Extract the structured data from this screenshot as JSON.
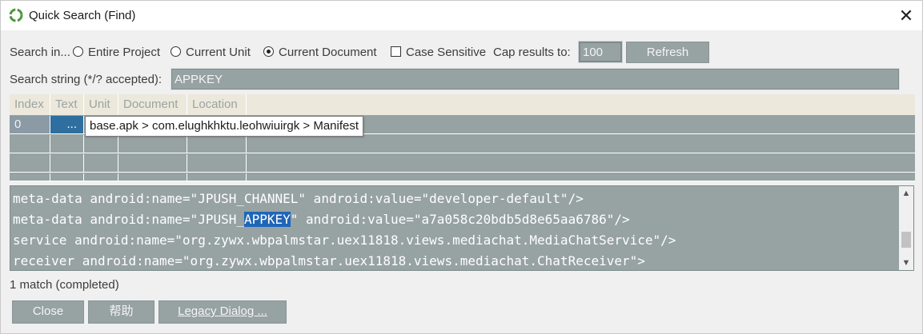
{
  "window": {
    "title": "Quick Search (Find)",
    "close_glyph": "✕"
  },
  "options": {
    "search_in_label": "Search in...",
    "scope_options": [
      {
        "label": "Entire Project",
        "checked": false
      },
      {
        "label": "Current Unit",
        "checked": false
      },
      {
        "label": "Current Document",
        "checked": true
      }
    ],
    "case_sensitive_label": "Case Sensitive",
    "case_sensitive_checked": false,
    "cap_label": "Cap results to:",
    "cap_value": "100",
    "refresh_label": "Refresh"
  },
  "search": {
    "label": "Search string (*/? accepted):",
    "value": "APPKEY"
  },
  "results": {
    "columns": [
      "Index",
      "Text",
      "Unit",
      "Document",
      "Location"
    ],
    "rows": [
      {
        "index": "0",
        "text": "...",
        "unit": "",
        "document": "",
        "location": ""
      }
    ],
    "tooltip": "base.apk > com.elughkhktu.leohwiuirgk > Manifest"
  },
  "preview": {
    "lines": [
      {
        "before": "meta-data android:name=\"JPUSH_CHANNEL\" android:value=\"developer-default\"/>",
        "match": "",
        "after": ""
      },
      {
        "before": "meta-data android:name=\"JPUSH_",
        "match": "APPKEY",
        "after": "\" android:value=\"a7a058c20bdb5d8e65aa6786\"/>"
      },
      {
        "before": "service android:name=\"org.zywx.wbpalmstar.uex11818.views.mediachat.MediaChatService\"/>",
        "match": "",
        "after": ""
      },
      {
        "before": "receiver android:name=\"org.zywx.wbpalmstar.uex11818.views.mediachat.ChatReceiver\">",
        "match": "",
        "after": ""
      }
    ]
  },
  "status": "1 match (completed)",
  "buttons": {
    "close": "Close",
    "help": "帮助",
    "legacy": "Legacy Dialog ..."
  },
  "colors": {
    "field_bg": "#97a2a2",
    "header_bg": "#ece9dc",
    "highlight": "#1f66b8",
    "window_bg": "#f0f0f0"
  }
}
